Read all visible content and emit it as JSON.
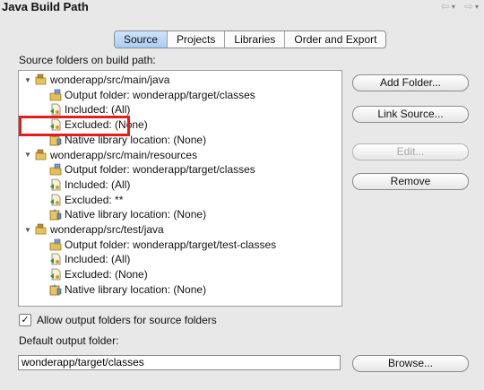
{
  "window": {
    "title": "Java Build Path"
  },
  "tabs": [
    "Source",
    "Projects",
    "Libraries",
    "Order and Export"
  ],
  "active_tab": "Source",
  "source_section": {
    "label": "Source folders on build path:"
  },
  "tree": [
    {
      "type": "folder",
      "label": "wonderapp/src/main/java",
      "expanded": true
    },
    {
      "type": "child",
      "kind": "output",
      "label": "Output folder: wonderapp/target/classes"
    },
    {
      "type": "child",
      "kind": "filter",
      "label": "Included: (All)"
    },
    {
      "type": "child",
      "kind": "filter",
      "label": "Excluded: (None)"
    },
    {
      "type": "child",
      "kind": "native",
      "label": "Native library location: (None)"
    },
    {
      "type": "folder",
      "label": "wonderapp/src/main/resources",
      "expanded": true
    },
    {
      "type": "child",
      "kind": "output",
      "label": "Output folder: wonderapp/target/classes"
    },
    {
      "type": "child",
      "kind": "filter",
      "label": "Included: (All)"
    },
    {
      "type": "child",
      "kind": "filter",
      "label": "Excluded: **",
      "highlighted": true
    },
    {
      "type": "child",
      "kind": "native",
      "label": "Native library location: (None)"
    },
    {
      "type": "folder",
      "label": "wonderapp/src/test/java",
      "expanded": true
    },
    {
      "type": "child",
      "kind": "output",
      "label": "Output folder: wonderapp/target/test-classes"
    },
    {
      "type": "child",
      "kind": "filter",
      "label": "Included: (All)"
    },
    {
      "type": "child",
      "kind": "filter",
      "label": "Excluded: (None)"
    },
    {
      "type": "child",
      "kind": "native",
      "label": "Native library location: (None)"
    }
  ],
  "buttons": {
    "add_folder": "Add Folder...",
    "link_source": "Link Source...",
    "edit": "Edit...",
    "remove": "Remove",
    "browse": "Browse..."
  },
  "allow_output": {
    "label": "Allow output folders for source folders",
    "checked": true
  },
  "default_output": {
    "label": "Default output folder:",
    "value": "wonderapp/target/classes"
  },
  "colors": {
    "highlight": "#e0201a",
    "tab_active": "#a9cdf4"
  }
}
